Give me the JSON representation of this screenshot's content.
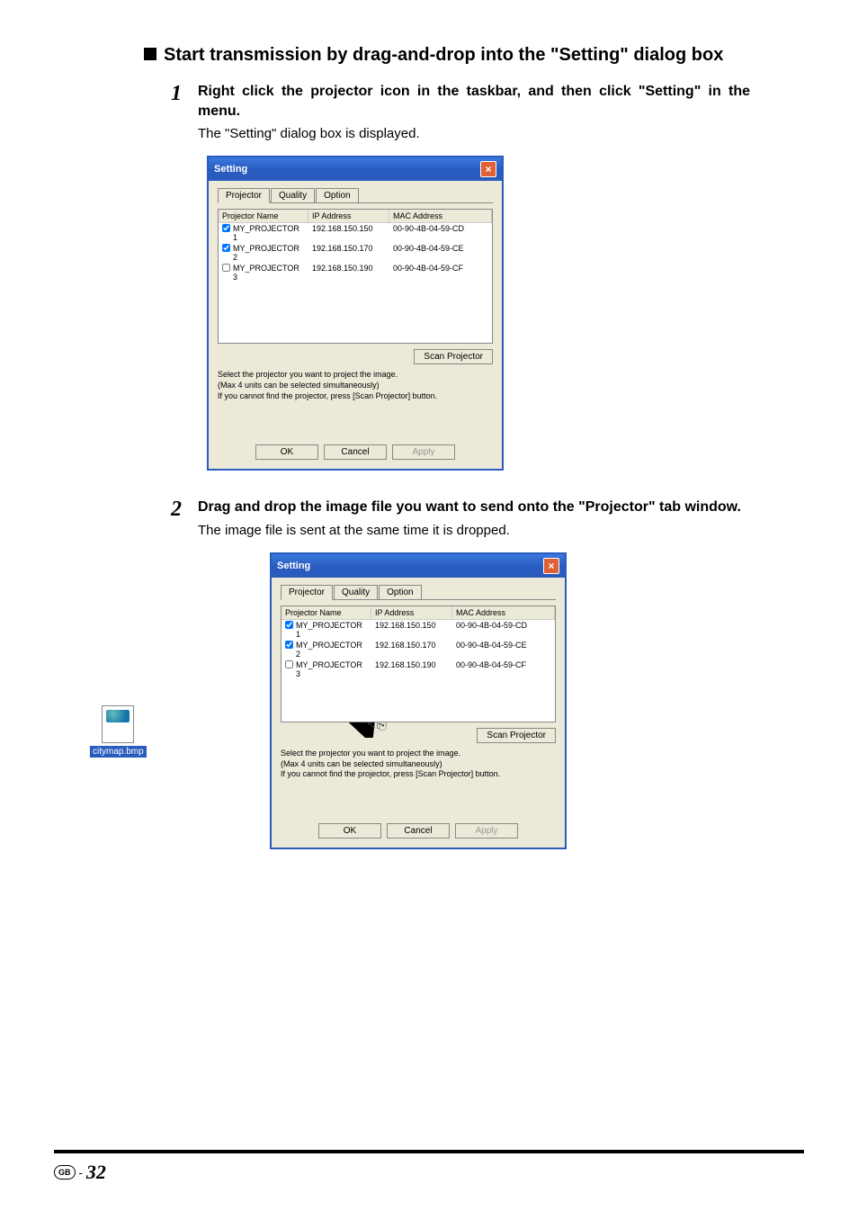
{
  "section_title": "Start transmission by drag-and-drop into the \"Setting\" dialog box",
  "steps": [
    {
      "num": "1",
      "instruction": "Right click the projector icon in the taskbar, and then click \"Setting\" in the menu.",
      "sub": "The \"Setting\" dialog box is displayed."
    },
    {
      "num": "2",
      "instruction": "Drag and drop the image file you want to send onto the \"Projector\" tab window.",
      "sub": "The image file is sent at the same time it is dropped."
    }
  ],
  "dialog": {
    "title": "Setting",
    "tabs": [
      "Projector",
      "Quality",
      "Option"
    ],
    "columns": {
      "name": "Projector Name",
      "ip": "IP Address",
      "mac": "MAC Address"
    },
    "rows": [
      {
        "checked": true,
        "name": "MY_PROJECTOR 1",
        "ip": "192.168.150.150",
        "mac": "00-90-4B-04-59-CD"
      },
      {
        "checked": true,
        "name": "MY_PROJECTOR 2",
        "ip": "192.168.150.170",
        "mac": "00-90-4B-04-59-CE"
      },
      {
        "checked": false,
        "name": "MY_PROJECTOR 3",
        "ip": "192.168.150.190",
        "mac": "00-90-4B-04-59-CF"
      }
    ],
    "scan_btn": "Scan Projector",
    "info1": "Select the projector you want to project the image.",
    "info2": "(Max 4 units can be selected simultaneously)",
    "info3": "If you cannot find the projector, press [Scan Projector] button.",
    "ok": "OK",
    "cancel": "Cancel",
    "apply": "Apply"
  },
  "file_label": "citymap.bmp",
  "footer": {
    "gb": "GB",
    "dash": "-",
    "page": "32"
  }
}
